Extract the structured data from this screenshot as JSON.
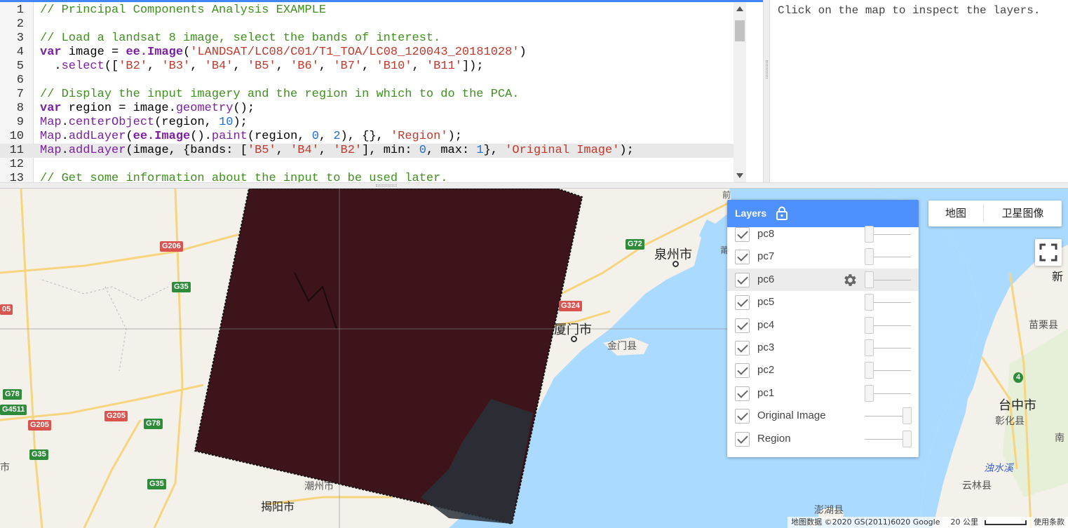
{
  "editor": {
    "line_numbers": [
      "1",
      "2",
      "3",
      "4",
      "5",
      "6",
      "7",
      "8",
      "9",
      "10",
      "11",
      "12",
      "13"
    ],
    "active_line": 11
  },
  "inspector": {
    "hint": "Click on the map to inspect the layers."
  },
  "layers_panel": {
    "title": "Layers",
    "lock_icon": "lock-icon",
    "layers": [
      {
        "name": "pc8",
        "checked": true,
        "opacity": 0.0
      },
      {
        "name": "pc7",
        "checked": true,
        "opacity": 0.0
      },
      {
        "name": "pc6",
        "checked": true,
        "opacity": 0.0,
        "hovered": true,
        "settings_icon": "gear-icon"
      },
      {
        "name": "pc5",
        "checked": true,
        "opacity": 0.0
      },
      {
        "name": "pc4",
        "checked": true,
        "opacity": 0.0
      },
      {
        "name": "pc3",
        "checked": true,
        "opacity": 0.0
      },
      {
        "name": "pc2",
        "checked": true,
        "opacity": 0.0
      },
      {
        "name": "pc1",
        "checked": true,
        "opacity": 0.0
      },
      {
        "name": "Original Image",
        "checked": true,
        "opacity": 1.0
      },
      {
        "name": "Region",
        "checked": true,
        "opacity": 1.0
      }
    ]
  },
  "map_type": {
    "map": "地图",
    "satellite": "卫星图像"
  },
  "map_labels": {
    "quanzhou": "泉州市",
    "xiamen": "厦门市",
    "jinmen": "金门县",
    "chaozhou": "潮州市",
    "jieyang": "揭阳市",
    "penghu": "澎湖县",
    "taizhong": "台中市",
    "zhanghua": "彰化县",
    "miaoli": "苗栗县",
    "yunlin": "云林县",
    "xin": "新",
    "nan": "南",
    "shi": "市",
    "zhuoshui": "浊水溪",
    "qian": "前",
    "pu": "莆"
  },
  "road_shields": [
    "G206",
    "G72",
    "G35",
    "G324",
    "G78",
    "G205",
    "G205",
    "G78",
    "G35",
    "G35",
    "G4511",
    "05",
    "4"
  ],
  "attribution": {
    "data": "地图数据 ©2020 GS(2011)6020 Google",
    "scale": "20 公里",
    "terms": "使用条款"
  },
  "colors": {
    "accent": "#4d90fe",
    "water": "#aadaff",
    "land": "#f3f1ea",
    "image": "#3d1419"
  }
}
